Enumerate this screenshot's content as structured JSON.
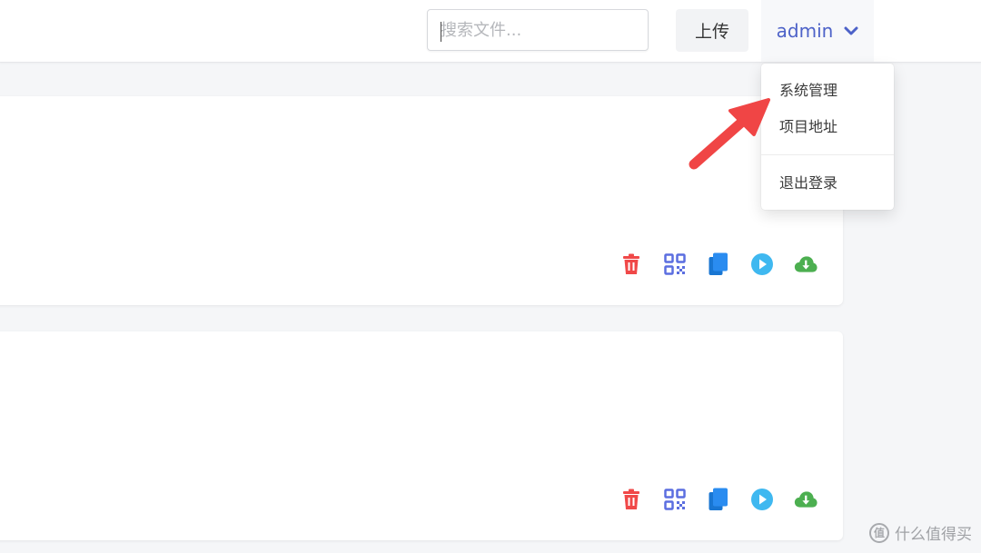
{
  "header": {
    "search": {
      "value": "",
      "placeholder": "搜索文件..."
    },
    "upload_label": "上传",
    "user_label": "admin"
  },
  "dropdown": {
    "items": [
      {
        "label": "系统管理"
      },
      {
        "label": "项目地址"
      },
      {
        "label": "退出登录"
      }
    ]
  },
  "files": [
    {
      "actions": [
        "delete-icon",
        "qrcode-icon",
        "copy-icon",
        "play-icon",
        "download-icon"
      ]
    },
    {
      "actions": [
        "delete-icon",
        "qrcode-icon",
        "copy-icon",
        "play-icon",
        "download-icon"
      ]
    }
  ],
  "colors": {
    "accent": "#4d62c8",
    "delete": "#f04848",
    "qrcode": "#5b6ee0",
    "copy": "#2a8cf0",
    "play": "#3fb8f0",
    "download": "#4caf50",
    "annotation_arrow": "#f04545"
  },
  "watermark": {
    "text": "什么值得买"
  }
}
